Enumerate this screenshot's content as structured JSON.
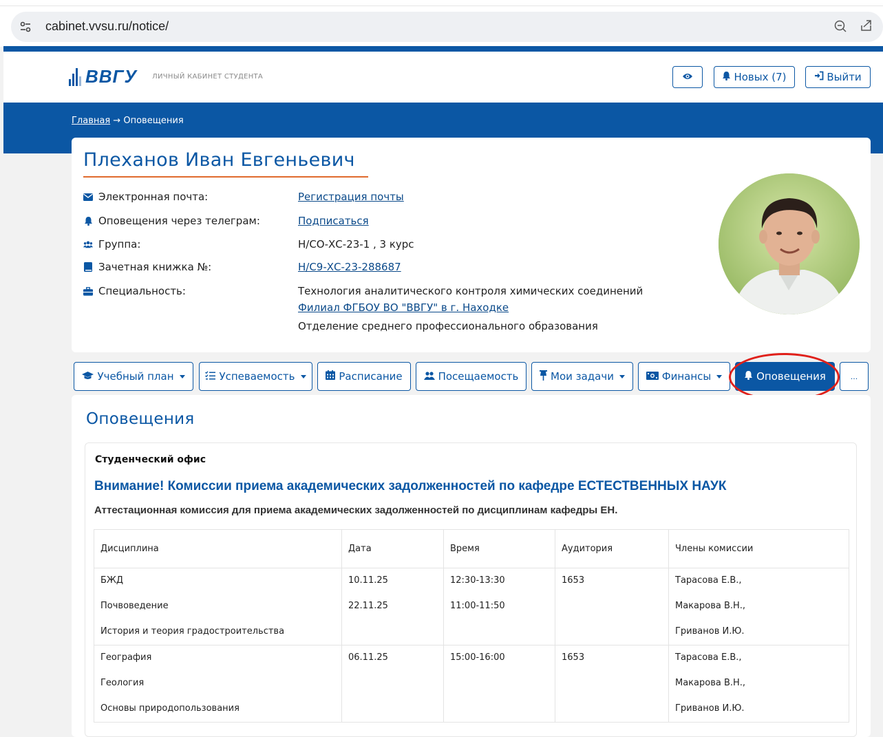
{
  "browser": {
    "url": "cabinet.vvsu.ru/notice/",
    "icons": {
      "site": "site-settings-icon",
      "zoom": "zoom-out-icon",
      "share": "share-icon"
    }
  },
  "header": {
    "logo_text": "ВВГУ",
    "logo_subtitle": "ЛИЧНЫЙ КАБИНЕТ СТУДЕНТА",
    "new_label": "Новых (7)",
    "logout_label": "Выйти",
    "accent_color": "#0b57a4"
  },
  "breadcrumb": {
    "home": "Главная",
    "separator": "→",
    "current": "Оповещения"
  },
  "profile": {
    "name": "Плеханов Иван Евгеньевич",
    "rows": [
      {
        "label": "Электронная почта:",
        "value": "Регистрация почты",
        "icon": "envelope-icon"
      },
      {
        "label": "Оповещения через телеграм:",
        "value": "Подписаться",
        "icon": "bell-icon"
      },
      {
        "label": "Группа:",
        "value": "Н/СО-ХС-23-1 , 3 курс",
        "icon": "users-icon"
      },
      {
        "label": "Зачетная книжка №:",
        "value": "Н/С9-ХС-23-288687",
        "icon": "book-icon"
      },
      {
        "label": "Специальность:",
        "icon": "briefcase-icon",
        "values": [
          "Технология аналитического контроля химических соединений",
          "Филиал ФГБОУ ВО \"ВВГУ\" в г. Находке",
          "Отделение среднего профессионального образования"
        ]
      }
    ]
  },
  "tabs": [
    {
      "label": "Учебный план",
      "icon": "graduation-cap-icon"
    },
    {
      "label": "Успеваемость",
      "icon": "list-check-icon"
    },
    {
      "label": "Расписание",
      "icon": "calendar-icon"
    },
    {
      "label": "Посещаемость",
      "icon": "users-icon"
    },
    {
      "label": "Мои задачи",
      "icon": "pin-icon"
    },
    {
      "label": "Финансы",
      "icon": "money-icon"
    },
    {
      "label": "Оповещения",
      "icon": "bell-icon"
    },
    {
      "label": "..."
    }
  ],
  "notices": {
    "title": "Оповещения",
    "source": "Студенческий офис",
    "heading": "Внимание! Комиссии приема академических задолженностей по кафедре ЕСТЕСТВЕННЫХ НАУК",
    "subheading": "Аттестационная комиссия для приема академических задолженностей по дисциплинам кафедры ЕН.",
    "columns": [
      "Дисциплина",
      "Дата",
      "Время",
      "Аудитория",
      "Члены комиссии"
    ],
    "rows": [
      {
        "discipline": [
          "БЖД",
          "Почвоведение",
          "История и теория градостроительства"
        ],
        "date": [
          "10.11.25",
          "22.11.25"
        ],
        "time": [
          "12:30-13:30",
          "11:00-11:50"
        ],
        "room": [
          "1653"
        ],
        "members": [
          "Тарасова Е.В.,",
          "Макарова В.Н.,",
          "Гриванов И.Ю."
        ]
      },
      {
        "discipline": [
          "География",
          "Геология",
          "Основы природопользования"
        ],
        "date": [
          "06.11.25"
        ],
        "time": [
          "15:00-16:00"
        ],
        "room": [
          "1653"
        ],
        "members": [
          "Тарасова Е.В.,",
          "Макарова В.Н.,",
          "Гриванов И.Ю."
        ]
      }
    ]
  }
}
